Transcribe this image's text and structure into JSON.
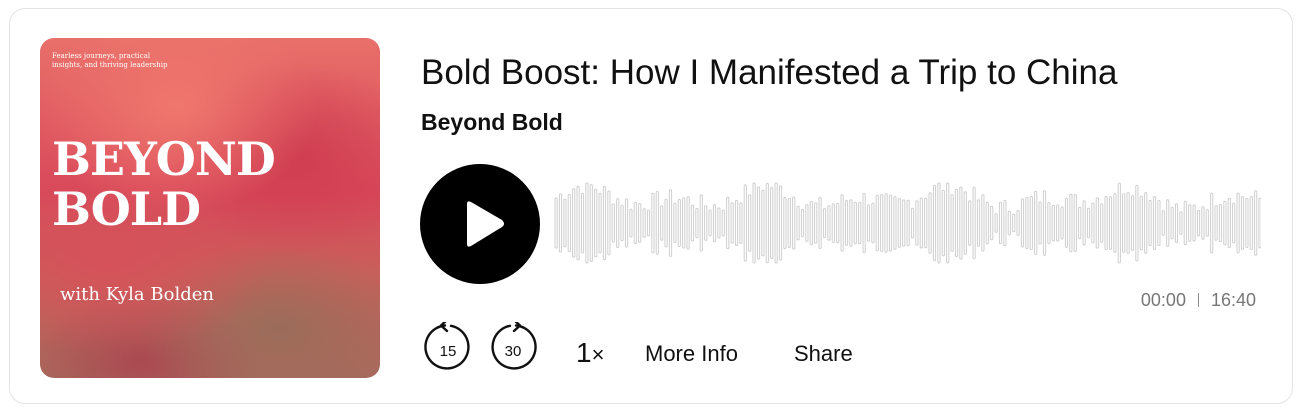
{
  "artwork": {
    "tagline": "Fearless journeys, practical insights, and thriving leadership",
    "title_line1": "BEYOND",
    "title_line2": "BOLD",
    "subtitle": "with Kyla Bolden"
  },
  "episode": {
    "title": "Bold Boost: How I Manifested a Trip to China",
    "show": "Beyond Bold"
  },
  "player": {
    "play_icon": "play-icon",
    "current_time": "00:00",
    "duration": "16:40",
    "progress": 0,
    "skip_back_seconds": "15",
    "skip_forward_seconds": "30",
    "speed": "1",
    "speed_suffix": "×",
    "more_info_label": "More Info",
    "share_label": "Share"
  },
  "colors": {
    "play_button": "#000000",
    "waveform": "#cfcfcf",
    "time_text": "#777777"
  }
}
